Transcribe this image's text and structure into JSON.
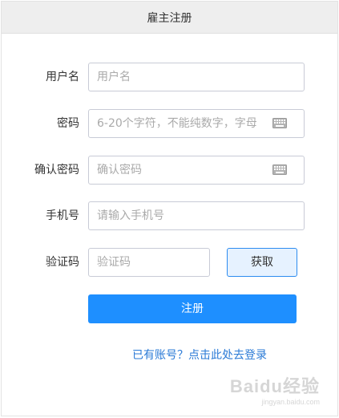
{
  "header": {
    "title": "雇主注册"
  },
  "form": {
    "username": {
      "label": "用户名",
      "placeholder": "用户名"
    },
    "password": {
      "label": "密码",
      "placeholder": "6-20个字符，不能纯数字，字母"
    },
    "confirm": {
      "label": "确认密码",
      "placeholder": "确认密码"
    },
    "phone": {
      "label": "手机号",
      "placeholder": "请输入手机号"
    },
    "code": {
      "label": "验证码",
      "placeholder": "验证码",
      "get_label": "获取"
    },
    "submit_label": "注册",
    "login_link": "已有账号？点击此处去登录"
  },
  "watermark": {
    "text": "Baidu经验",
    "sub": "jingyan.baidu.com"
  },
  "icons": {
    "keyboard": "keyboard-icon"
  },
  "colors": {
    "accent": "#1e8fff",
    "link": "#2a7ad6",
    "get_border": "#2d8cf0"
  }
}
